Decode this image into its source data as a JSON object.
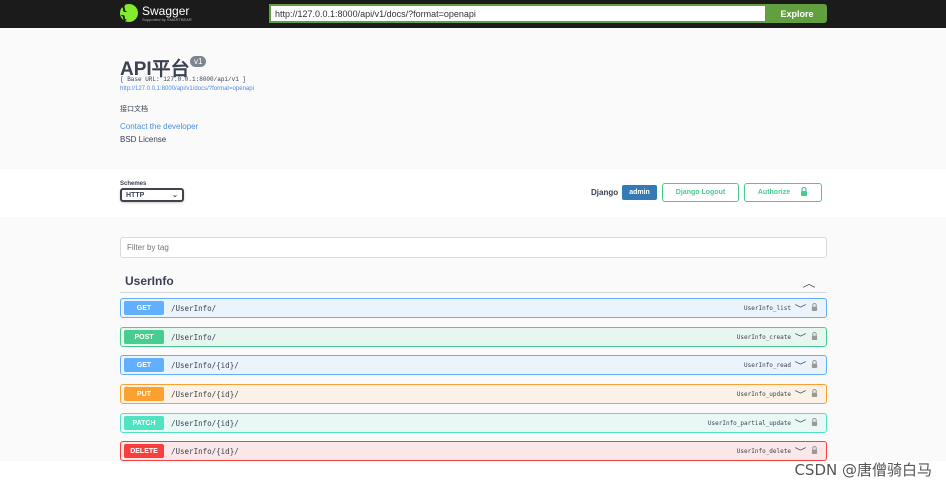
{
  "topbar": {
    "logo_name": "Swagger",
    "logo_sub": "Supported by SMARTBEAR",
    "url_value": "http://127.0.0.1:8000/api/v1/docs/?format=openapi",
    "explore_label": "Explore"
  },
  "info": {
    "title": "API平台",
    "version": "v1",
    "base_url": "[ Base URL: 127.0.0.1:8000/api/v1 ]",
    "spec_url": "http://127.0.0.1:8000/api/v1/docs/?format=openapi",
    "description": "接口文档",
    "contact": "Contact the developer",
    "license": "BSD License"
  },
  "schemes": {
    "label": "Schemes",
    "selected": "HTTP"
  },
  "auth": {
    "django_label": "Django",
    "user_badge": "admin",
    "logout_label": "Django Logout",
    "authorize_label": "Authorize"
  },
  "filter": {
    "placeholder": "Filter by tag"
  },
  "tag": {
    "name": "UserInfo"
  },
  "operations": [
    {
      "method": "GET",
      "path": "/UserInfo/",
      "operation_id": "UserInfo_list"
    },
    {
      "method": "POST",
      "path": "/UserInfo/",
      "operation_id": "UserInfo_create"
    },
    {
      "method": "GET",
      "path": "/UserInfo/{id}/",
      "operation_id": "UserInfo_read"
    },
    {
      "method": "PUT",
      "path": "/UserInfo/{id}/",
      "operation_id": "UserInfo_update"
    },
    {
      "method": "PATCH",
      "path": "/UserInfo/{id}/",
      "operation_id": "UserInfo_partial_update"
    },
    {
      "method": "DELETE",
      "path": "/UserInfo/{id}/",
      "operation_id": "UserInfo_delete"
    }
  ],
  "watermark": "CSDN @唐僧骑白马",
  "icons": {
    "collapse": "chevron-up-icon",
    "expand": "chevron-down-icon",
    "lock": "lock-icon",
    "logo": "swagger-logo-icon"
  },
  "colors": {
    "topbar": "#1b1b1b",
    "explore": "#62a03f",
    "get": "#61affe",
    "post": "#49cc90",
    "put": "#fca130",
    "patch": "#50e3c2",
    "delete": "#f93e3e",
    "admin_badge": "#337ab7"
  }
}
